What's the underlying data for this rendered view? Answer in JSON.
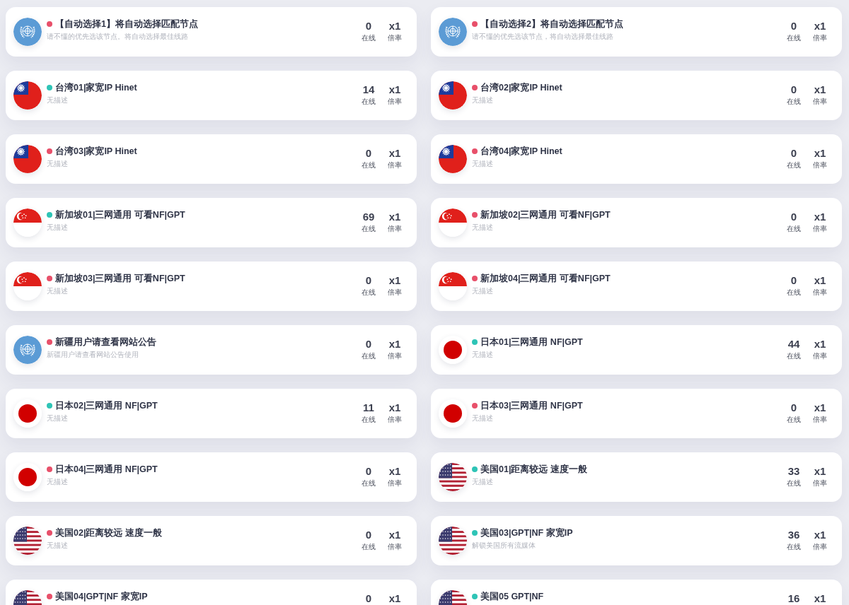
{
  "servers": [
    {
      "kind": "un",
      "color": "#e8506a",
      "name": "【自动选择1】将自动选择匹配节点",
      "description": "请不懂的优先选该节点。将自动选择最佳线路",
      "online": "0",
      "online_label": "在线",
      "rate": "x1",
      "rate_label": "倍率"
    },
    {
      "kind": "un",
      "color": "#e8506a",
      "name": "【自动选择2】将自动选择匹配节点",
      "description": "请不懂的优先选该节点，将自动选择最佳线路",
      "online": "0",
      "online_label": "在线",
      "rate": "x1",
      "rate_label": "倍率"
    },
    {
      "kind": "taiwan",
      "color": "#2ec4b6",
      "name": "台湾01|家宽IP Hinet",
      "description": "无描述",
      "online": "14",
      "online_label": "在线",
      "rate": "x1",
      "rate_label": "倍率"
    },
    {
      "kind": "taiwan",
      "color": "#e8506a",
      "name": "台湾02|家宽IP Hinet",
      "description": "无描述",
      "online": "0",
      "online_label": "在线",
      "rate": "x1",
      "rate_label": "倍率"
    },
    {
      "kind": "taiwan",
      "color": "#e8506a",
      "name": "台湾03|家宽IP Hinet",
      "description": "无描述",
      "online": "0",
      "online_label": "在线",
      "rate": "x1",
      "rate_label": "倍率"
    },
    {
      "kind": "taiwan",
      "color": "#e8506a",
      "name": "台湾04|家宽IP Hinet",
      "description": "无描述",
      "online": "0",
      "online_label": "在线",
      "rate": "x1",
      "rate_label": "倍率"
    },
    {
      "kind": "singapore",
      "color": "#2ec4b6",
      "name": "新加坡01|三网通用 可看NF|GPT",
      "description": "无描述",
      "online": "69",
      "online_label": "在线",
      "rate": "x1",
      "rate_label": "倍率"
    },
    {
      "kind": "singapore",
      "color": "#e8506a",
      "name": "新加坡02|三网通用 可看NF|GPT",
      "description": "无描述",
      "online": "0",
      "online_label": "在线",
      "rate": "x1",
      "rate_label": "倍率"
    },
    {
      "kind": "singapore",
      "color": "#e8506a",
      "name": "新加坡03|三网通用 可看NF|GPT",
      "description": "无描述",
      "online": "0",
      "online_label": "在线",
      "rate": "x1",
      "rate_label": "倍率"
    },
    {
      "kind": "singapore",
      "color": "#e8506a",
      "name": "新加坡04|三网通用 可看NF|GPT",
      "description": "无描述",
      "online": "0",
      "online_label": "在线",
      "rate": "x1",
      "rate_label": "倍率"
    },
    {
      "kind": "un",
      "color": "#e8506a",
      "name": "新疆用户请查看网站公告",
      "description": "新疆用户请查看网站公告使用",
      "online": "0",
      "online_label": "在线",
      "rate": "x1",
      "rate_label": "倍率"
    },
    {
      "kind": "japan",
      "color": "#2ec4b6",
      "name": "日本01|三网通用 NF|GPT",
      "description": "无描述",
      "online": "44",
      "online_label": "在线",
      "rate": "x1",
      "rate_label": "倍率"
    },
    {
      "kind": "japan",
      "color": "#2ec4b6",
      "name": "日本02|三网通用 NF|GPT",
      "description": "无描述",
      "online": "11",
      "online_label": "在线",
      "rate": "x1",
      "rate_label": "倍率"
    },
    {
      "kind": "japan",
      "color": "#e8506a",
      "name": "日本03|三网通用 NF|GPT",
      "description": "无描述",
      "online": "0",
      "online_label": "在线",
      "rate": "x1",
      "rate_label": "倍率"
    },
    {
      "kind": "japan",
      "color": "#e8506a",
      "name": "日本04|三网通用 NF|GPT",
      "description": "无描述",
      "online": "0",
      "online_label": "在线",
      "rate": "x1",
      "rate_label": "倍率"
    },
    {
      "kind": "usa",
      "color": "#2ec4b6",
      "name": "美国01|距离较远 速度一般",
      "description": "无描述",
      "online": "33",
      "online_label": "在线",
      "rate": "x1",
      "rate_label": "倍率"
    },
    {
      "kind": "usa",
      "color": "#e8506a",
      "name": "美国02|距离较远 速度一般",
      "description": "无描述",
      "online": "0",
      "online_label": "在线",
      "rate": "x1",
      "rate_label": "倍率"
    },
    {
      "kind": "usa",
      "color": "#2ec4b6",
      "name": "美国03|GPT|NF 家宽IP",
      "description": "解锁美国所有流媒体",
      "online": "36",
      "online_label": "在线",
      "rate": "x1",
      "rate_label": "倍率"
    },
    {
      "kind": "usa",
      "color": "#e8506a",
      "name": "美国04|GPT|NF 家宽IP",
      "online": "0",
      "rate": "x1"
    },
    {
      "kind": "usa",
      "color": "#2ec4b6",
      "name": "美国05 GPT|NF",
      "online": "16",
      "rate": "x1"
    }
  ]
}
